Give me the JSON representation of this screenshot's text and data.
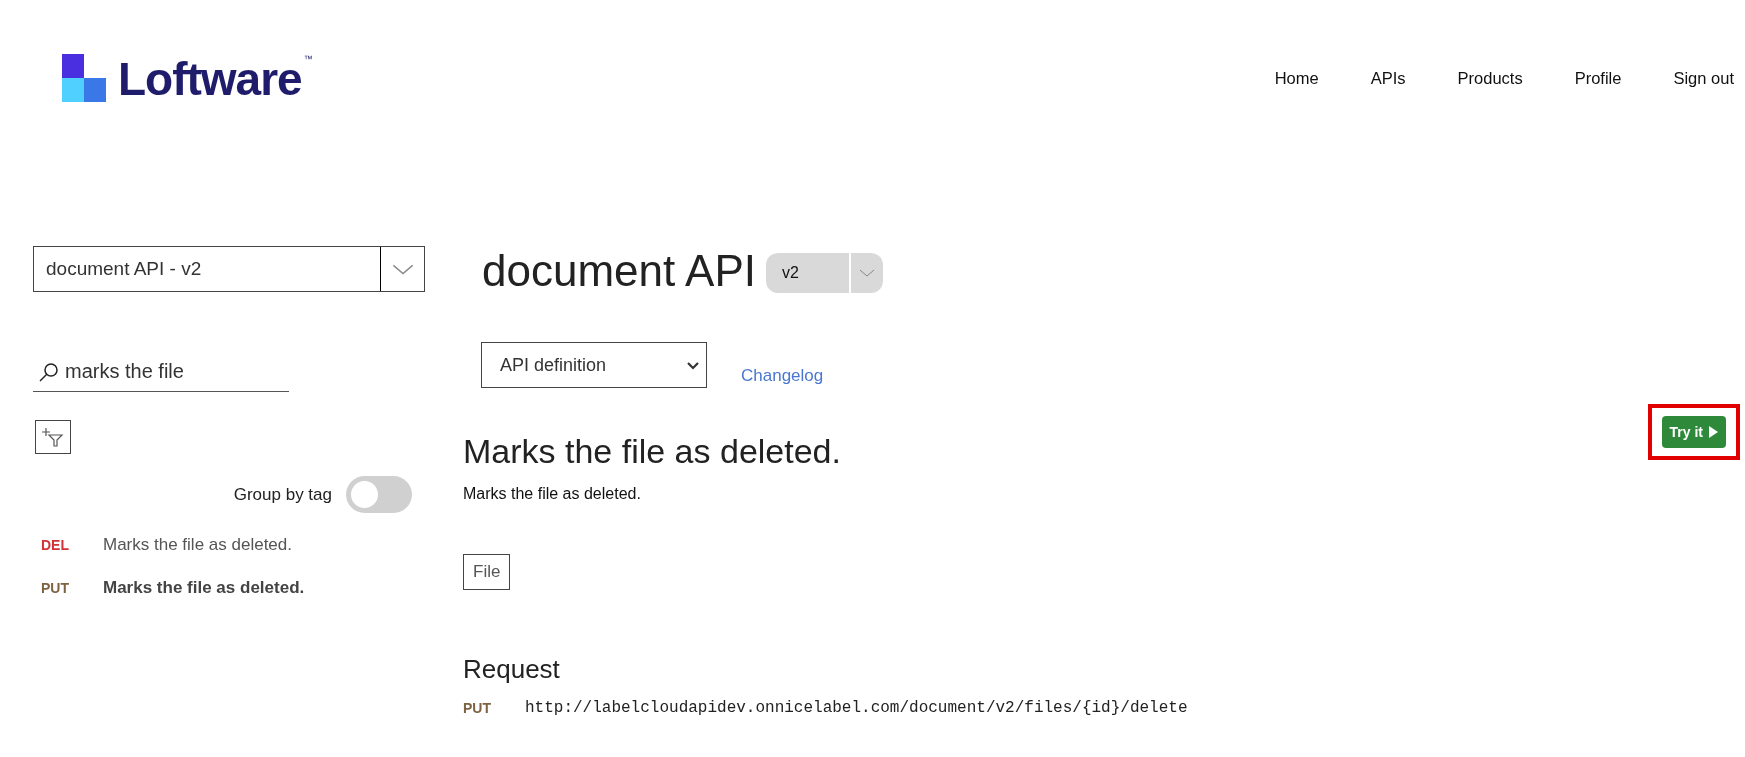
{
  "header": {
    "logo": {
      "wordmark": "Loftware",
      "trademark": "™"
    },
    "nav": [
      "Home",
      "APIs",
      "Products",
      "Profile",
      "Sign out"
    ]
  },
  "sidebar": {
    "api_select": {
      "value": "document API - v2"
    },
    "search": {
      "value": "marks the file"
    },
    "group_by_tag": {
      "label": "Group by tag",
      "on": false
    },
    "operations": [
      {
        "method": "DEL",
        "name": "Marks the file as deleted.",
        "selected": false
      },
      {
        "method": "PUT",
        "name": "Marks the file as deleted.",
        "selected": true
      }
    ]
  },
  "main": {
    "title": "document API",
    "version": "v2",
    "view_select": {
      "value": "API definition"
    },
    "changelog": "Changelog",
    "try_it": {
      "label": "Try it",
      "highlighted": true
    },
    "operation": {
      "title": "Marks the file as deleted.",
      "description": "Marks the file as deleted.",
      "tags": [
        "File"
      ]
    },
    "request": {
      "heading": "Request",
      "method": "PUT",
      "url": "http://labelcloudapidev.onnicelabel.com/document/v2/files/{id}/delete"
    }
  }
}
